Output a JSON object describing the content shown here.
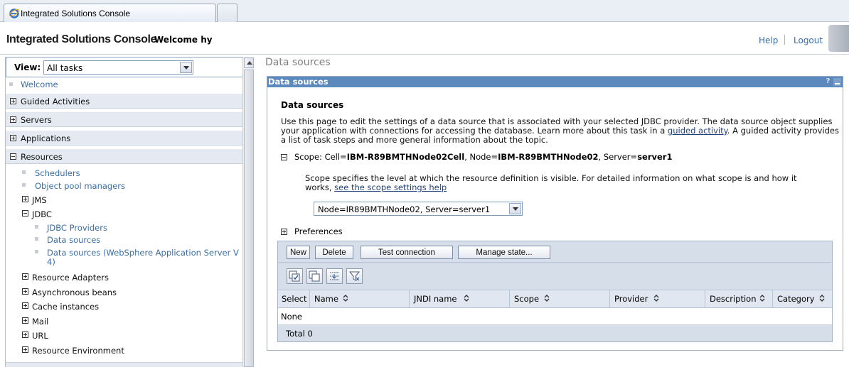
{
  "browser": {
    "tab_title": "Integrated Solutions Console"
  },
  "banner": {
    "title": "Integrated Solutions Console",
    "welcome": "Welcome hy",
    "help": "Help",
    "logout": "Logout"
  },
  "nav": {
    "view_label": "View:",
    "view_value": "All tasks",
    "welcome": "Welcome",
    "categories": [
      {
        "label": "Guided Activities",
        "expanded": false
      },
      {
        "label": "Servers",
        "expanded": false
      },
      {
        "label": "Applications",
        "expanded": false
      },
      {
        "label": "Resources",
        "expanded": true
      }
    ],
    "resources": {
      "schedulers": "Schedulers",
      "object_pool_managers": "Object pool managers",
      "jms": "JMS",
      "jdbc": "JDBC",
      "jdbc_providers": "JDBC Providers",
      "data_sources": "Data sources",
      "data_sources_v4_line1": "Data sources (WebSphere Application Server V",
      "data_sources_v4_line2": "4)",
      "resource_adapters": "Resource Adapters",
      "asynchronous_beans": "Asynchronous beans",
      "cache_instances": "Cache instances",
      "mail": "Mail",
      "url": "URL",
      "resource_environment": "Resource Environment"
    }
  },
  "content": {
    "page_title": "Data sources",
    "panel_title": "Data sources",
    "panel_help": "?",
    "heading": "Data sources",
    "description_part1": "Use this page to edit the settings of a data source that is associated with your selected JDBC provider. The data source object supplies your application with connections for accessing the database. Learn more about this task in a ",
    "description_link": "guided activity",
    "description_part2": ". A guided activity provides a list of task steps and more general information about the topic.",
    "scope": {
      "label": "Scope: Cell=",
      "cell": "IBM-R89BMTHNode02Cell",
      "node_label": ", Node=",
      "node": "IBM-R89BMTHNode02",
      "server_label": ", Server=",
      "server": "server1"
    },
    "scope_help_text": "Scope specifies the level at which the resource definition is visible. For detailed information on what scope is and how it works, ",
    "scope_help_link": "see the scope settings help",
    "scope_select_value": "Node=IR89BMTHNode02, Server=server1",
    "preferences": "Preferences"
  },
  "table": {
    "buttons": {
      "new": "New",
      "delete": "Delete",
      "test_connection": "Test connection",
      "manage_state": "Manage state..."
    },
    "icons": [
      "select-all-icon",
      "deselect-all-icon",
      "show-filter-icon",
      "clear-filter-icon"
    ],
    "columns": [
      "Select",
      "Name",
      "JNDI name",
      "Scope",
      "Provider",
      "Description",
      "Category"
    ],
    "empty_text": "None",
    "total": "Total 0"
  }
}
